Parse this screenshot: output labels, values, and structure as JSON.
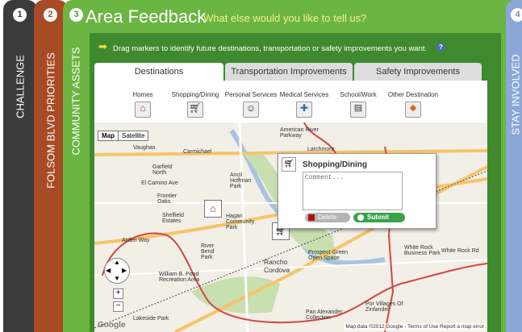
{
  "steps": [
    {
      "num": "1",
      "label": "CHALLENGE"
    },
    {
      "num": "2",
      "label": "FOLSOM BLVD PRIORITIES"
    },
    {
      "num": "3",
      "label": "COMMUNITY ASSETS"
    },
    {
      "num": "4",
      "label": "STAY INVOLVED"
    }
  ],
  "header": {
    "title": "Area Feedback",
    "subtitle": "What else would you like to tell us?"
  },
  "instruction": "Drag markers to identify future destinations, transportation or safety improvements you want.",
  "help_icon": "?",
  "tabs": [
    "Destinations",
    "Transportation Improvements",
    "Safety Improvements"
  ],
  "categories": [
    "Homes",
    "Shopping/Dining",
    "Personal Services",
    "Medical Services",
    "School/Work",
    "Other Destination"
  ],
  "map": {
    "type_buttons": [
      "Map",
      "Satellite"
    ],
    "labels": [
      "Vaughan",
      "Carmichael",
      "Garfield North",
      "El Camino Ave",
      "Frontier Oaks",
      "Shelfield Estates",
      "Arden Way",
      "River Bend Park",
      "William B. Pond Recreation Area",
      "Rancho Cordova",
      "Prospect Green Open Space",
      "White Rock Business Park",
      "White Rock Rd",
      "Por Villages Of Zinfandel",
      "Lakeside Park",
      "American River Parkway",
      "Larchmont",
      "Hagan Community Park",
      "Ancil Hoffman Park",
      "Pan Alexander Collection"
    ],
    "zoom_in": "+",
    "zoom_out": "−",
    "attribution": "Map data ©2012 Google - Terms of Use  Report a map error",
    "google_logo": "Google"
  },
  "popup": {
    "title": "Shopping/Dining",
    "comment": "Comment...",
    "delete_label": "Delete",
    "submit_label": "Submit"
  },
  "colors": {
    "step1": "#3b3b3b",
    "step2": "#a84a23",
    "step3": "#6bb543",
    "step4": "#8aa7d8",
    "submit": "#3aa24a"
  }
}
